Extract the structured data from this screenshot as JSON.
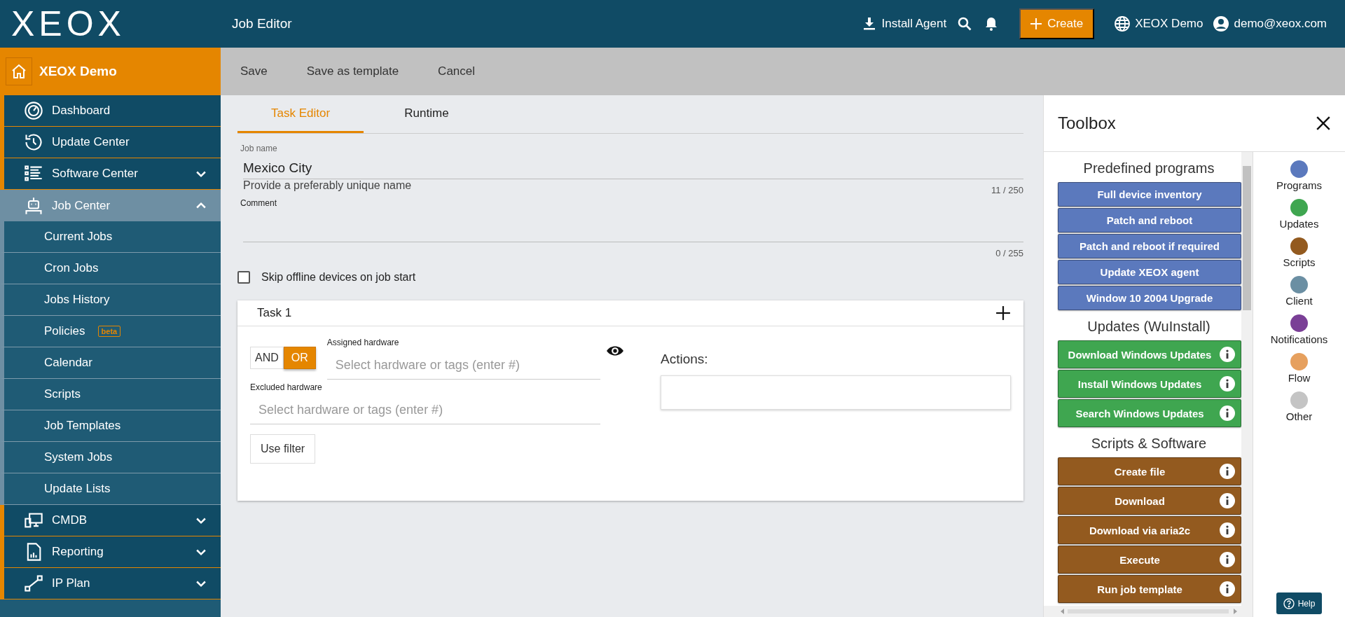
{
  "topbar": {
    "logo": "XEOX",
    "title": "Job Editor",
    "install_agent": "Install Agent",
    "create": "Create",
    "tenant": "XEOX Demo",
    "user": "demo@xeox.com"
  },
  "sidebar": {
    "header": "XEOX Demo",
    "items": [
      {
        "label": "Dashboard"
      },
      {
        "label": "Update Center"
      },
      {
        "label": "Software Center",
        "expanded": false
      },
      {
        "label": "Job Center",
        "expanded": true,
        "children": [
          {
            "label": "Current Jobs"
          },
          {
            "label": "Cron Jobs"
          },
          {
            "label": "Jobs History"
          },
          {
            "label": "Policies",
            "badge": "beta"
          },
          {
            "label": "Calendar"
          },
          {
            "label": "Scripts"
          },
          {
            "label": "Job Templates"
          },
          {
            "label": "System Jobs"
          },
          {
            "label": "Update Lists"
          }
        ]
      },
      {
        "label": "CMDB",
        "expanded": false
      },
      {
        "label": "Reporting",
        "expanded": false
      },
      {
        "label": "IP Plan",
        "expanded": false
      }
    ]
  },
  "actions": [
    "Save",
    "Save as template",
    "Cancel"
  ],
  "editor": {
    "tabs": [
      {
        "label": "Task Editor",
        "selected": true
      },
      {
        "label": "Runtime",
        "selected": false
      }
    ],
    "job_name": {
      "label": "Job name",
      "value": "Mexico City",
      "hint": "Provide a preferably unique name",
      "counter": "11 / 250"
    },
    "comment": {
      "label": "Comment",
      "counter": "0 / 255"
    },
    "skip_offline": {
      "label": "Skip offline devices on job start",
      "checked": false
    },
    "task": {
      "title": "Task 1",
      "logic": [
        {
          "label": "AND",
          "selected": false
        },
        {
          "label": "OR",
          "selected": true
        }
      ],
      "assigned": {
        "label": "Assigned hardware",
        "placeholder": "Select hardware or tags (enter #)"
      },
      "excluded": {
        "label": "Excluded hardware",
        "placeholder": "Select hardware or tags (enter #)"
      },
      "filter_button": "Use filter",
      "actions_label": "Actions:"
    }
  },
  "toolbox": {
    "title": "Toolbox",
    "sections": [
      {
        "title": "Predefined programs",
        "items": [
          {
            "label": "Full device inventory",
            "color": "#5b79bd",
            "info": false
          },
          {
            "label": "Patch and reboot",
            "color": "#5b79bd",
            "info": false
          },
          {
            "label": "Patch and reboot if required",
            "color": "#5b79bd",
            "info": false
          },
          {
            "label": "Update XEOX agent",
            "color": "#5b79bd",
            "info": false
          },
          {
            "label": "Window 10 2004 Upgrade",
            "color": "#5b79bd",
            "info": false
          }
        ]
      },
      {
        "title": "Updates (WuInstall)",
        "items": [
          {
            "label": "Download Windows Updates",
            "color": "#3fa650",
            "info": true
          },
          {
            "label": "Install Windows Updates",
            "color": "#3fa650",
            "info": true
          },
          {
            "label": "Search Windows Updates",
            "color": "#3fa650",
            "info": true
          }
        ]
      },
      {
        "title": "Scripts & Software",
        "items": [
          {
            "label": "Create file",
            "color": "#935a1f",
            "info": true
          },
          {
            "label": "Download",
            "color": "#935a1f",
            "info": true
          },
          {
            "label": "Download via aria2c",
            "color": "#935a1f",
            "info": true
          },
          {
            "label": "Execute",
            "color": "#935a1f",
            "info": true
          },
          {
            "label": "Run job template",
            "color": "#935a1f",
            "info": true
          }
        ]
      }
    ],
    "legend": [
      {
        "label": "Programs",
        "color": "#5b79bd"
      },
      {
        "label": "Updates",
        "color": "#3fa650"
      },
      {
        "label": "Scripts",
        "color": "#935a1f"
      },
      {
        "label": "Client",
        "color": "#6b8fa3"
      },
      {
        "label": "Notifications",
        "color": "#7a3f96"
      },
      {
        "label": "Flow",
        "color": "#e6a05e"
      },
      {
        "label": "Other",
        "color": "#c4c4c4"
      }
    ],
    "help": "Help"
  }
}
